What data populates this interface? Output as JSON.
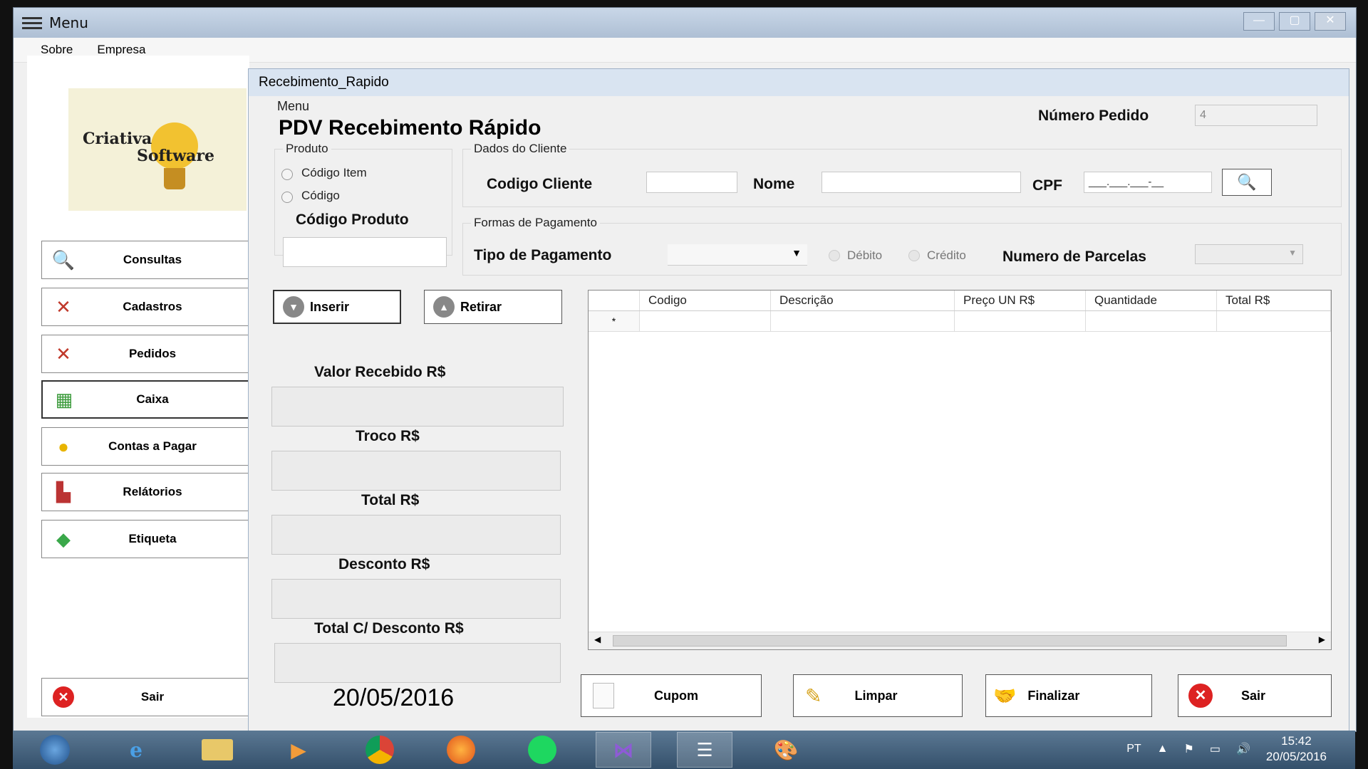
{
  "outer_window": {
    "title": "Menu",
    "menubar": [
      "Sobre",
      "Empresa"
    ]
  },
  "sidebar": {
    "logo_line1": "Criativa",
    "logo_line2": "Software",
    "items": [
      {
        "label": "Consultas",
        "icon": "magnifier-icon"
      },
      {
        "label": "Cadastros",
        "icon": "tools-icon"
      },
      {
        "label": "Pedidos",
        "icon": "tools-icon"
      },
      {
        "label": "Caixa",
        "icon": "cash-register-icon"
      },
      {
        "label": "Contas a Pagar",
        "icon": "coin-icon"
      },
      {
        "label": "Relátorios",
        "icon": "report-icon"
      },
      {
        "label": "Etiqueta",
        "icon": "tag-icon"
      }
    ],
    "exit_label": "Sair"
  },
  "inner_window": {
    "title": "Recebimento_Rapido",
    "menu_label": "Menu",
    "heading": "PDV Recebimento Rápido",
    "numero_pedido_label": "Número Pedido",
    "numero_pedido_value": "4",
    "produto_group": "Produto",
    "radio_codigo_item": "Código Item",
    "radio_codigo": "Código",
    "codigo_produto_label": "Código Produto",
    "cliente_group": "Dados do Cliente",
    "codigo_cliente_label": "Codigo Cliente",
    "nome_label": "Nome",
    "cpf_label": "CPF",
    "cpf_mask": "___.___.___-__",
    "pagamento_group": "Formas de Pagamento",
    "tipo_pagamento_label": "Tipo de Pagamento",
    "radio_debito": "Débito",
    "radio_credito": "Crédito",
    "parcelas_label": "Numero de Parcelas",
    "inserir_label": "Inserir",
    "retirar_label": "Retirar",
    "valor_recebido_label": "Valor Recebido R$",
    "troco_label": "Troco R$",
    "total_label": "Total R$",
    "desconto_label": "Desconto R$",
    "total_desconto_label": "Total C/ Desconto R$",
    "date": "20/05/2016",
    "grid_columns": [
      "Codigo",
      "Descrição",
      "Preço UN R$",
      "Quantidade",
      "Total R$"
    ],
    "grid_new_row_marker": "*",
    "buttons": {
      "cupom": "Cupom",
      "limpar": "Limpar",
      "finalizar": "Finalizar",
      "sair": "Sair"
    }
  },
  "taskbar": {
    "lang": "PT",
    "time": "15:42",
    "date": "20/05/2016"
  }
}
